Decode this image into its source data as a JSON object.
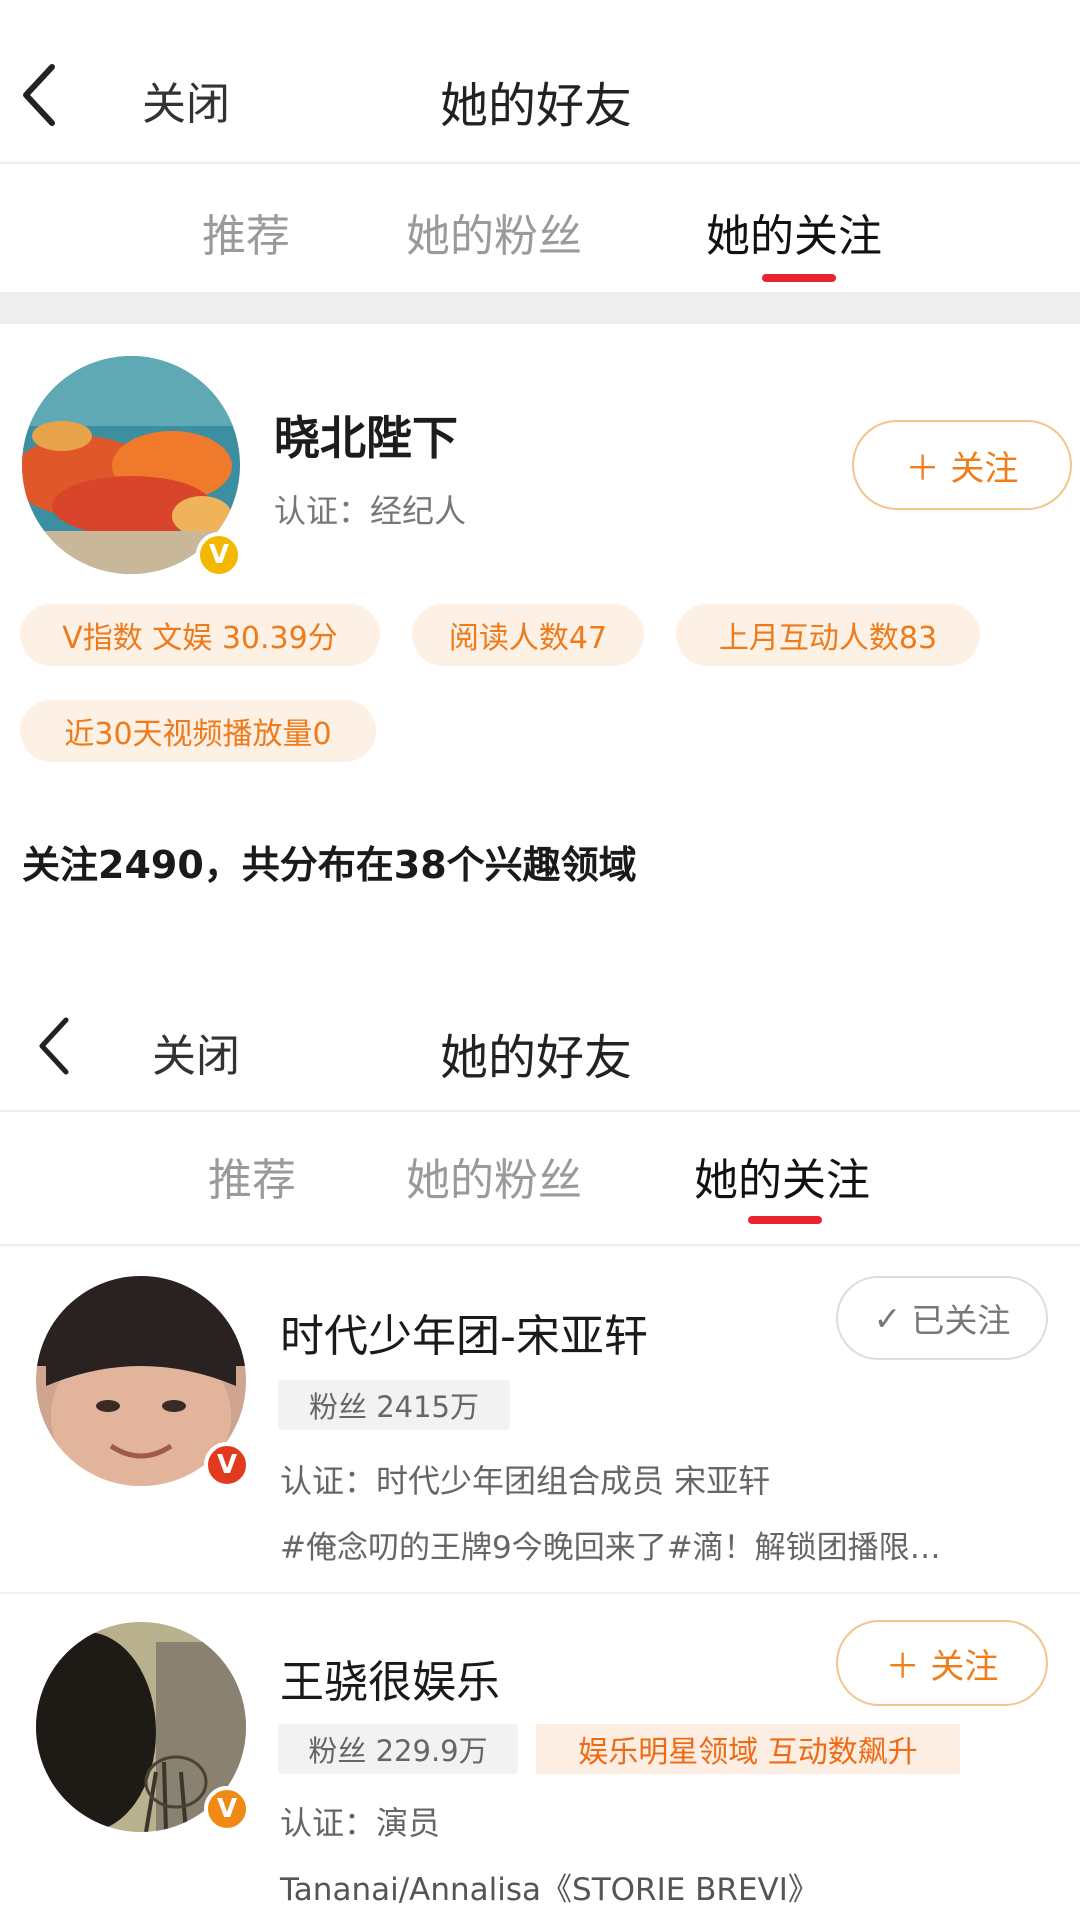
{
  "screen1": {
    "header": {
      "close_label": "关闭",
      "title": "她的好友"
    },
    "tabs": [
      {
        "label": "推荐"
      },
      {
        "label": "她的粉丝"
      },
      {
        "label": "她的关注"
      }
    ],
    "profile": {
      "name": "晓北陛下",
      "verification": "认证：经纪人",
      "follow_label": "＋ 关注",
      "badge": "V",
      "tags": [
        "V指数 文娱 30.39分",
        "阅读人数47",
        "上月互动人数83",
        "近30天视频播放量0"
      ],
      "summary": "关注2490，共分布在38个兴趣领域"
    }
  },
  "screen2": {
    "header": {
      "close_label": "关闭",
      "title": "她的好友"
    },
    "tabs": [
      {
        "label": "推荐"
      },
      {
        "label": "她的粉丝"
      },
      {
        "label": "她的关注"
      }
    ],
    "users": [
      {
        "name": "时代少年团-宋亚轩",
        "fans": "粉丝 2415万",
        "verification": "认证：时代少年团组合成员 宋亚轩",
        "recent": "#俺念叨的王牌9今晚回来了#滴！解锁团播限…",
        "button": "已关注",
        "badge": "V"
      },
      {
        "name": "王骁很娱乐",
        "fans": "粉丝 229.9万",
        "hot_tag": "娱乐明星领域 互动数飙升",
        "verification": "认证：演员",
        "recent": "Tananai/Annalisa《STORIE BREVI》",
        "button": "＋ 关注",
        "badge": "V"
      }
    ]
  },
  "colors": {
    "accent_red": "#e8242e",
    "accent_orange": "#f07d18",
    "badge_gold": "#f5b800"
  }
}
